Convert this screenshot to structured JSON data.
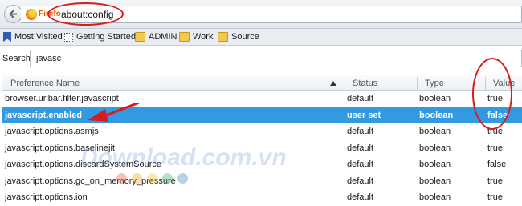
{
  "browser": {
    "brand_label": "Firefo",
    "url": "about:config"
  },
  "bookmarks": [
    {
      "label": "Most Visited",
      "icon": "bookmarks-icon"
    },
    {
      "label": "Getting Started",
      "icon": "page-icon"
    },
    {
      "label": "ADMIN",
      "icon": "folder-icon"
    },
    {
      "label": "Work",
      "icon": "folder-icon"
    },
    {
      "label": "Source",
      "icon": "folder-icon"
    }
  ],
  "search": {
    "label": "Search:",
    "value": "javasc"
  },
  "table": {
    "columns": [
      "Preference Name",
      "Status",
      "Type",
      "Value"
    ],
    "rows": [
      {
        "name": "browser.urlbar.filter.javascript",
        "status": "default",
        "type": "boolean",
        "value": "true"
      },
      {
        "name": "javascript.enabled",
        "status": "user set",
        "type": "boolean",
        "value": "false",
        "selected": true
      },
      {
        "name": "javascript.options.asmjs",
        "status": "default",
        "type": "boolean",
        "value": "true"
      },
      {
        "name": "javascript.options.baselinejit",
        "status": "default",
        "type": "boolean",
        "value": "true"
      },
      {
        "name": "javascript.options.discardSystemSource",
        "status": "default",
        "type": "boolean",
        "value": "false"
      },
      {
        "name": "javascript.options.gc_on_memory_pressure",
        "status": "default",
        "type": "boolean",
        "value": "true"
      },
      {
        "name": "javascript.options.ion",
        "status": "default",
        "type": "boolean",
        "value": "true"
      }
    ]
  },
  "watermark": "Download.com.vn",
  "colors": {
    "annotation_red": "#d81b1b",
    "selection_blue": "#3399e0"
  }
}
